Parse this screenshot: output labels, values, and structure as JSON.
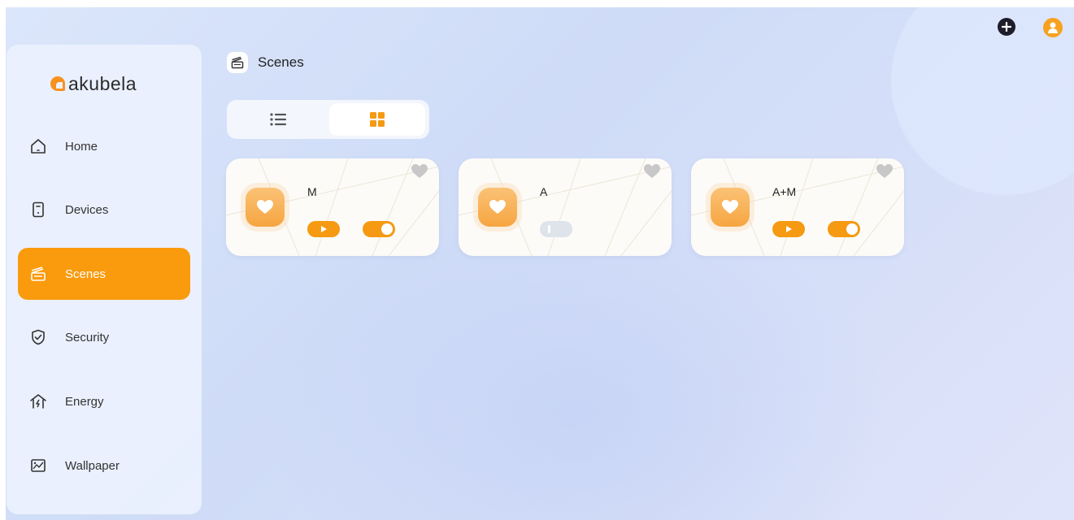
{
  "app": {
    "logo_text": "akubela"
  },
  "sidebar": {
    "items": [
      {
        "label": "Home",
        "icon": "home-icon"
      },
      {
        "label": "Devices",
        "icon": "devices-icon"
      },
      {
        "label": "Scenes",
        "icon": "scenes-icon",
        "active": true
      },
      {
        "label": "Security",
        "icon": "shield-icon"
      },
      {
        "label": "Energy",
        "icon": "energy-icon"
      },
      {
        "label": "Wallpaper",
        "icon": "wallpaper-icon"
      }
    ]
  },
  "header": {
    "title": "Scenes",
    "icon": "scenes-icon"
  },
  "topbar": {
    "add_icon": "plus-icon",
    "user_icon": "user-icon"
  },
  "view_toggle": {
    "options": [
      "list-view-icon",
      "grid-view-icon"
    ],
    "selected": "grid-view-icon"
  },
  "scenes": [
    {
      "name": "M",
      "has_play": true,
      "enabled": true,
      "favorite": false
    },
    {
      "name": "A",
      "has_play": false,
      "enabled": false,
      "favorite": false
    },
    {
      "name": "A+M",
      "has_play": true,
      "enabled": true,
      "favorite": false
    }
  ],
  "colors": {
    "accent": "#fa9a0d",
    "background": "#d6e0f8",
    "text": "#222222"
  }
}
